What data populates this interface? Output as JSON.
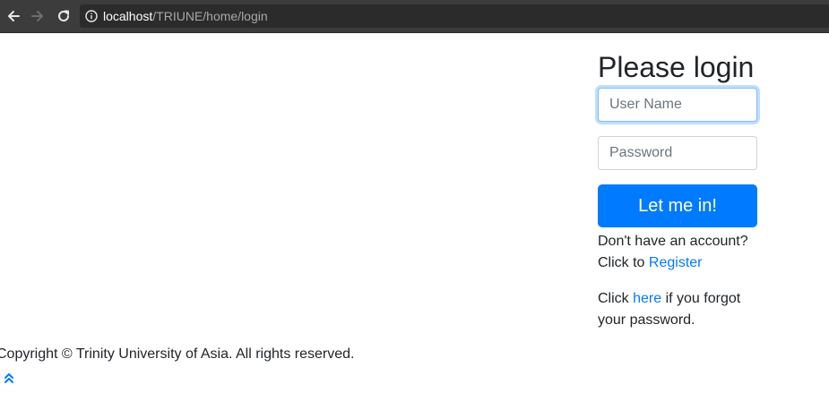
{
  "browser": {
    "url_host": "localhost",
    "url_path": "/TRIUNE/home/login",
    "icons": {
      "back": "arrow-left-icon",
      "forward": "arrow-right-icon",
      "reload": "reload-icon",
      "info": "info-icon"
    }
  },
  "login": {
    "title": "Please login",
    "username_placeholder": "User Name",
    "password_placeholder": "Password",
    "submit_label": "Let me in!",
    "register_line1": "Don't have an account?",
    "register_prefix": "Click to ",
    "register_link": "Register",
    "forgot_prefix": "Click ",
    "forgot_link": "here",
    "forgot_suffix": " if you forgot your password."
  },
  "footer": {
    "copyright": "Copyright © Trinity University of Asia. All rights reserved.",
    "back_to_top_icon": "double-chevron-up-icon"
  },
  "colors": {
    "primary": "#007bff",
    "browser_chrome": "#3c3c3c",
    "text": "#212529"
  }
}
